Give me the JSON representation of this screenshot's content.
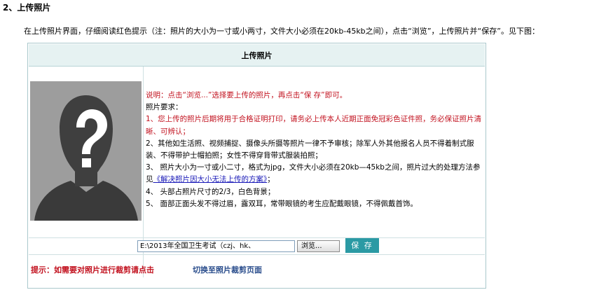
{
  "section": {
    "heading": "2、上传照片"
  },
  "intro": {
    "text": "在上传照片界面，仔细阅读红色提示（注：照片的大小为一寸或小两寸，文件大小必须在20kb-45kb之间），点击“浏览”，上传照片并“保存”。见下图："
  },
  "panel": {
    "title": "上传照片",
    "instruction": "说明：点击“浏览...”选择要上传的照片，再点击“保 存”即可。",
    "requirements_heading": "照片要求：",
    "items": [
      {
        "text": "1、您上传的照片后期将用于合格证明打印，请务必上传本人近期正面免冠彩色证件照，务必保证照片清晰、可辨认；",
        "red": true
      },
      {
        "text": "2、其他如生活照、视频捕捉、摄像头所摄等照片一律不予审核；除军人外其他报名人员不得着制式服装、不得带护士帽拍照；女性不得穿背带式服装拍照；",
        "red": false
      },
      {
        "text": "4、   头部占照片尺寸的2/3，白色背景；",
        "red": false
      },
      {
        "text": "5、   面部正面头发不得过眉，露双耳，常带眼镜的考生应配戴眼镜，不得佩戴首饰。",
        "red": false
      }
    ],
    "item3_before": "3、   照片大小为一寸或小二寸，格式为jpg，文件大小必须在20kb—45kb之间，照片过大的处理方法参见",
    "item3_link": "《解决照片因大小无法上传的方案》",
    "item3_after": "；",
    "file_path_value": "E:\\2013年全国卫生考试（czj、hk、",
    "browse_label": "浏览...",
    "save_label": "保 存",
    "footer_hint": "提示：如需要对照片进行裁剪请点击",
    "footer_link": "切换至照片裁剪页面",
    "placeholder_photo_icon": "unknown-person-icon"
  },
  "colors": {
    "red_text": "#c2121f",
    "header_bg": "#e6f2f2",
    "save_button": "#2b9aa4",
    "link": "#1a1ab8"
  }
}
